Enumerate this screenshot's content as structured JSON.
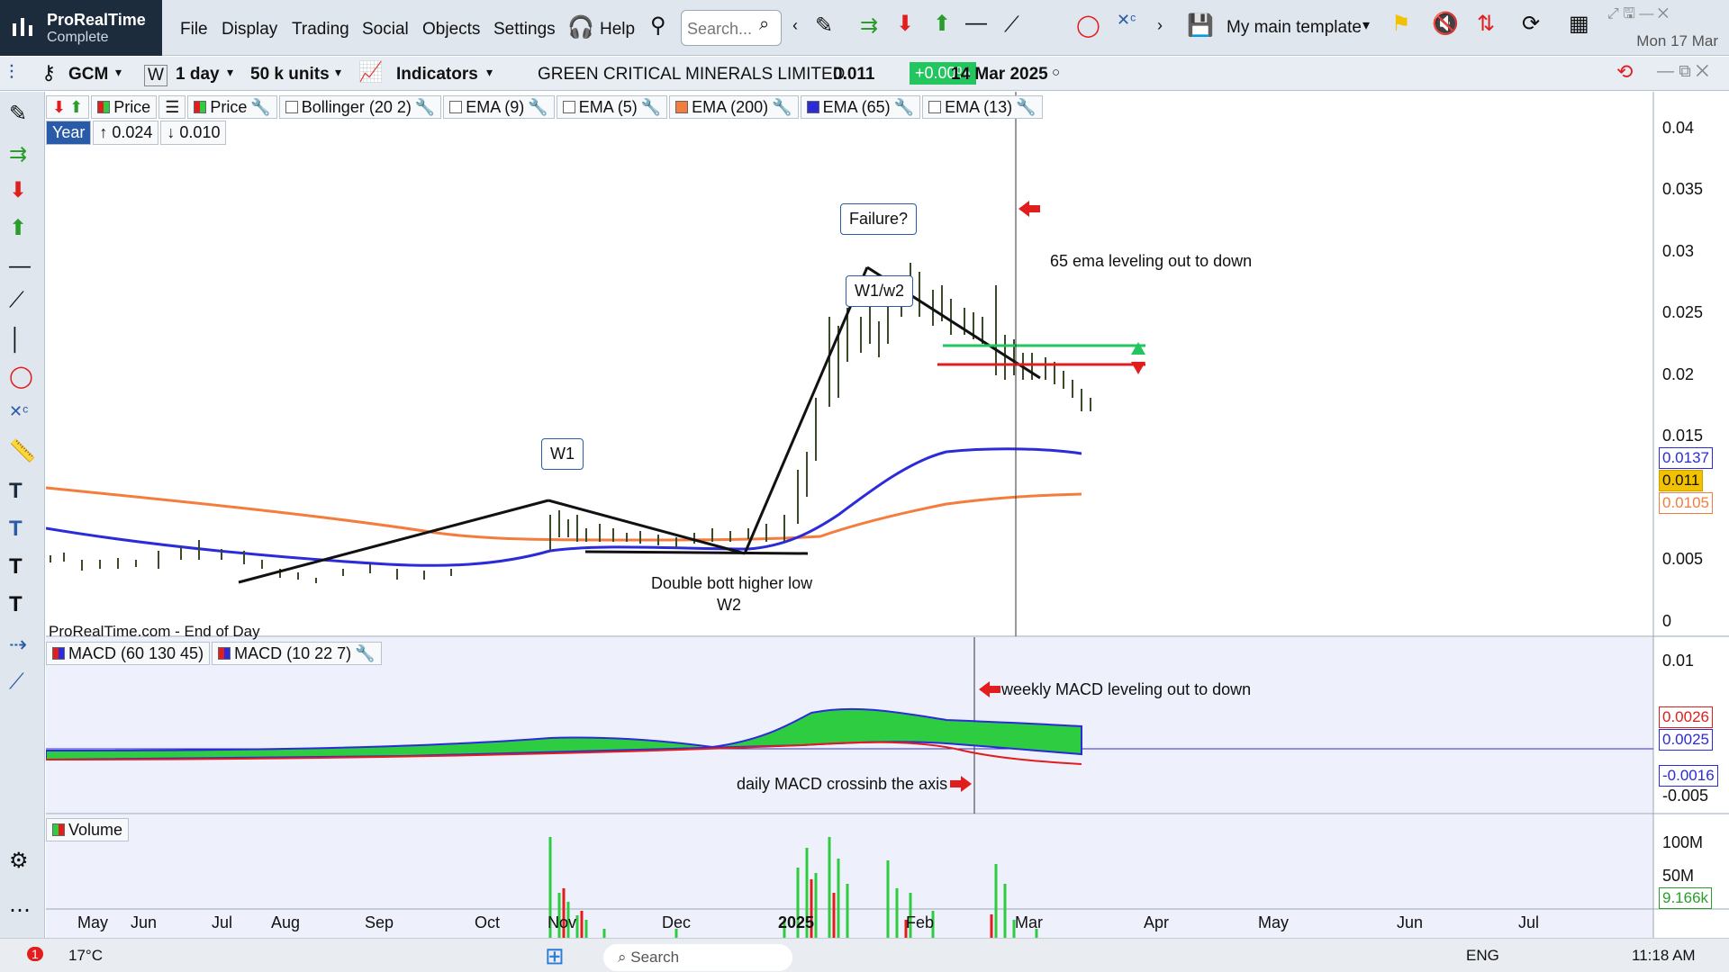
{
  "app": {
    "brand": "ProRealTime",
    "edition": "Complete",
    "date": "Mon 17 Mar"
  },
  "menu": [
    "File",
    "Display",
    "Trading",
    "Social",
    "Objects",
    "Settings",
    "Help"
  ],
  "search_placeholder": "Search...",
  "template_label": "My main template",
  "toolbar": {
    "ticker": "GCM",
    "period": "1 day",
    "units": "50 k units",
    "indicators": "Indicators",
    "instrument": "GREEN CRITICAL MINERALS LIMITED",
    "last": "0.011",
    "change": "+0.00%",
    "date": "14 Mar 2025",
    "timeframe_w": "W"
  },
  "legend": {
    "price1": "Price",
    "price2": "Price",
    "bollinger": "Bollinger (20 2)",
    "ema9": "EMA (9)",
    "ema5": "EMA (5)",
    "ema200": "EMA (200)",
    "ema65": "EMA (65)",
    "ema13": "EMA (13)",
    "year": "Year",
    "high": "↑ 0.024",
    "low": "↓ 0.010"
  },
  "source_label": "ProRealTime.com - End of Day",
  "macd_legend": {
    "m1": "MACD (60 130 45)",
    "m2": "MACD (10 22 7)"
  },
  "volume_legend": "Volume",
  "annotations": {
    "failure": "Failure?",
    "w1w2": "W1/w2",
    "w1": "W1",
    "double_bott": "Double bott higher low",
    "w2": "W2",
    "ema_note": "65 ema leveling out to down",
    "weekly_macd": "weekly MACD leveling out to down",
    "daily_macd": "daily MACD crossinb the axis"
  },
  "price_axis": [
    "0.04",
    "0.035",
    "0.03",
    "0.025",
    "0.02",
    "0.015",
    "0.005",
    "0"
  ],
  "price_badges": {
    "ema65": "0.0137",
    "last": "0.011",
    "ema200": "0.0105"
  },
  "macd_axis": [
    "0.01",
    "-0.005"
  ],
  "macd_badges": {
    "a": "0.0026",
    "b": "0.0025",
    "c": "-0.0016"
  },
  "volume_axis": [
    "100M",
    "50M"
  ],
  "volume_badge": "9.166k",
  "months": [
    "May",
    "Jun",
    "Jul",
    "Aug",
    "Sep",
    "Oct",
    "Nov",
    "Dec",
    "2025",
    "Feb",
    "Mar",
    "Apr",
    "May",
    "Jun",
    "Jul"
  ],
  "taskbar": {
    "temp": "17°C",
    "search": "Search",
    "lang": "ENG",
    "time": "11:18 AM",
    "badge": "1"
  },
  "colors": {
    "ema200": "#f47c3c",
    "ema65": "#2b2bd9",
    "green_line": "#22c55e",
    "red_line": "#e11d1d",
    "macd_fill": "#2ecc40"
  }
}
